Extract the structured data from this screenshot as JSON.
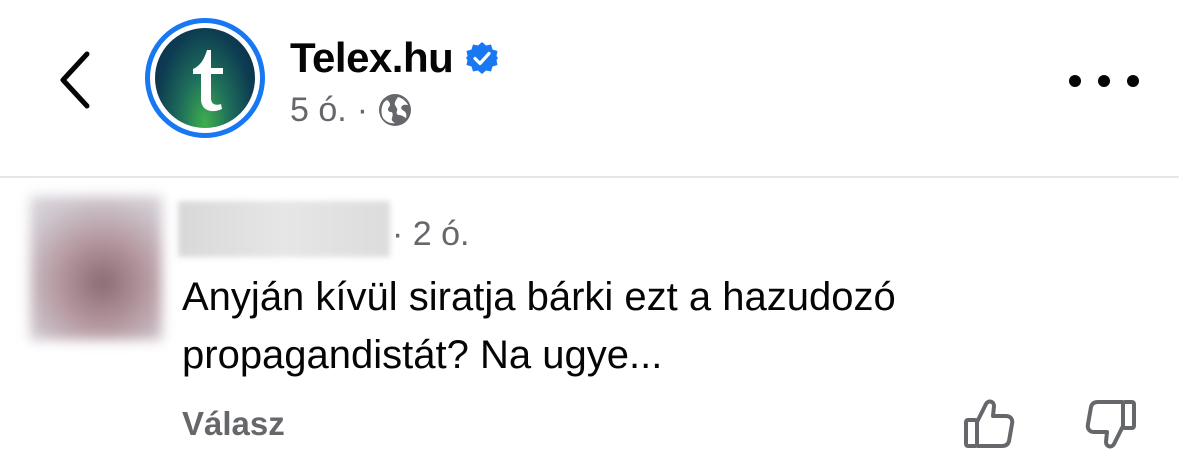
{
  "post": {
    "page_name": "Telex.hu",
    "time": "5 ó.",
    "separator": "·",
    "verified_icon": "verified-badge-icon",
    "privacy_icon": "globe-icon",
    "avatar_letter": "t",
    "accent_color": "#1877f2"
  },
  "comment": {
    "time": "· 2 ó.",
    "text": "Anyján kívül siratja bárki ezt a hazudozó propagandistát? Na ugye...",
    "reply_label": "Válasz",
    "upvote_icon": "thumbs-up-icon",
    "downvote_icon": "thumbs-down-icon"
  }
}
